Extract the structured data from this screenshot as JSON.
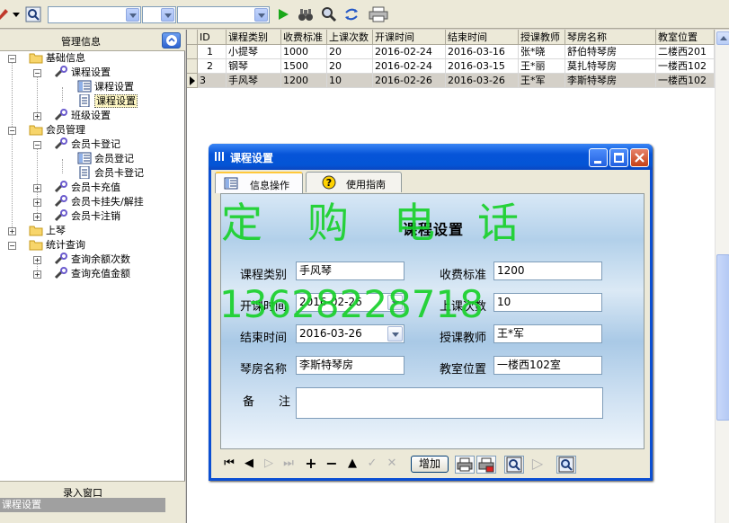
{
  "grid": {
    "columns": [
      "ID",
      "课程类别",
      "收费标准",
      "上课次数",
      "开课时间",
      "结束时间",
      "授课教师",
      "琴房名称",
      "教室位置"
    ],
    "rows": [
      [
        "1",
        "小提琴",
        "1000",
        "20",
        "2016-02-24",
        "2016-03-16",
        "张*晓",
        "舒伯特琴房",
        "二楼西201"
      ],
      [
        "2",
        "钢琴",
        "1500",
        "20",
        "2016-02-24",
        "2016-03-15",
        "王*丽",
        "莫扎特琴房",
        "一楼西102"
      ],
      [
        "3",
        "手风琴",
        "1200",
        "10",
        "2016-02-26",
        "2016-03-26",
        "王*军",
        "李斯特琴房",
        "一楼西102"
      ]
    ]
  },
  "left_panel": {
    "title": "管理信息",
    "tree": [
      {
        "label": "基础信息"
      },
      {
        "label": "课程设置"
      },
      {
        "label": "课程设置"
      },
      {
        "label": "课程设置"
      },
      {
        "label": "班级设置"
      },
      {
        "label": "会员管理"
      },
      {
        "label": "会员卡登记"
      },
      {
        "label": "会员登记"
      },
      {
        "label": "会员卡登记"
      },
      {
        "label": "会员卡充值"
      },
      {
        "label": "会员卡挂失/解挂"
      },
      {
        "label": "会员卡注销"
      },
      {
        "label": "上琴"
      },
      {
        "label": "统计查询"
      },
      {
        "label": "查询余额次数"
      },
      {
        "label": "查询充值金额"
      }
    ],
    "footer_label": "录入窗口",
    "footer_item": "课程设置"
  },
  "dialog": {
    "title": "课程设置",
    "tabs": [
      "信息操作",
      "使用指南"
    ],
    "form_title": "课程设置",
    "fields": {
      "category": {
        "label": "课程类别",
        "value": "手风琴"
      },
      "fee": {
        "label": "收费标准",
        "value": "1200"
      },
      "start": {
        "label": "开课时间",
        "value": "2016-02-26"
      },
      "sessions": {
        "label": "上课次数",
        "value": "10"
      },
      "end": {
        "label": "结束时间",
        "value": "2016-03-26"
      },
      "teacher": {
        "label": "授课教师",
        "value": "王*军"
      },
      "room": {
        "label": "琴房名称",
        "value": "李斯特琴房"
      },
      "classroom": {
        "label": "教室位置",
        "value": "一楼西102室"
      },
      "remark": {
        "label_a": "备",
        "label_b": "注",
        "value": ""
      }
    },
    "add_label": "增加"
  },
  "watermark": {
    "line1": [
      "定",
      "购",
      "电",
      "话"
    ],
    "phone": "13628228718"
  },
  "colors": {
    "titlebar": "#0654d8",
    "watermark": "#19d12b",
    "selection": "#fff8c4"
  }
}
